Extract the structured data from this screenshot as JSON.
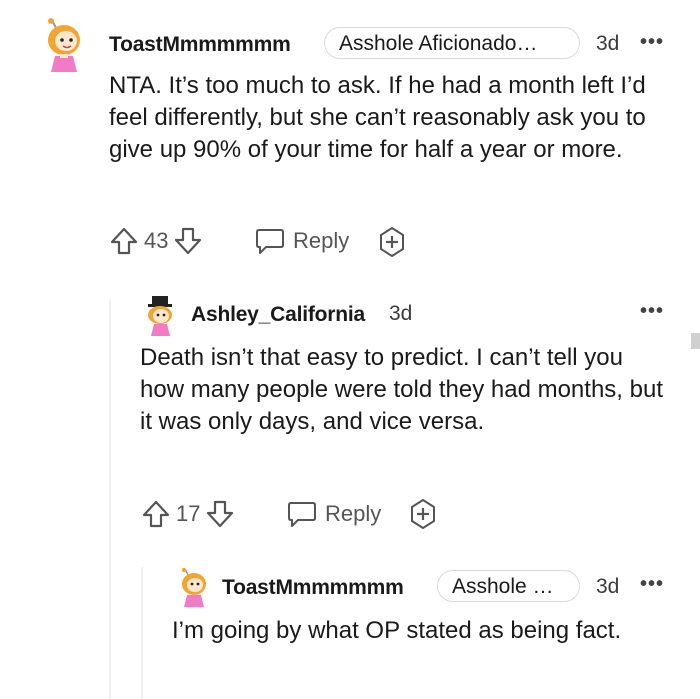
{
  "comments": [
    {
      "username": "ToastMmmmmmm",
      "flair": "Asshole Aficionado…",
      "age": "3d",
      "more": "•••",
      "body": "NTA. It’s too much to ask. If he had a month left I’d feel differently, but she can’t reasonably ask you to give up 90% of your time for half a year or more.",
      "score": "43",
      "reply_label": "Reply"
    },
    {
      "username": "Ashley_California",
      "age": "3d",
      "more": "•••",
      "body": "Death isn’t that easy to predict. I can’t tell you how many people were told they had months, but it was only days, and vice versa.",
      "score": "17",
      "reply_label": "Reply"
    },
    {
      "username": "ToastMmmmmmm",
      "flair": "Asshole …",
      "age": "3d",
      "more": "•••",
      "body": "I’m going by what OP stated as being fact."
    }
  ],
  "colors": {
    "text": "#1a1a1b",
    "muted": "#555555",
    "border": "#d7dadc",
    "thread_line": "#edeff1",
    "avatar_hair": "#f2a530",
    "avatar_dress": "#f37ac7"
  },
  "icons": [
    "upvote-icon",
    "downvote-icon",
    "reply-icon",
    "award-icon",
    "avatar-icon"
  ]
}
